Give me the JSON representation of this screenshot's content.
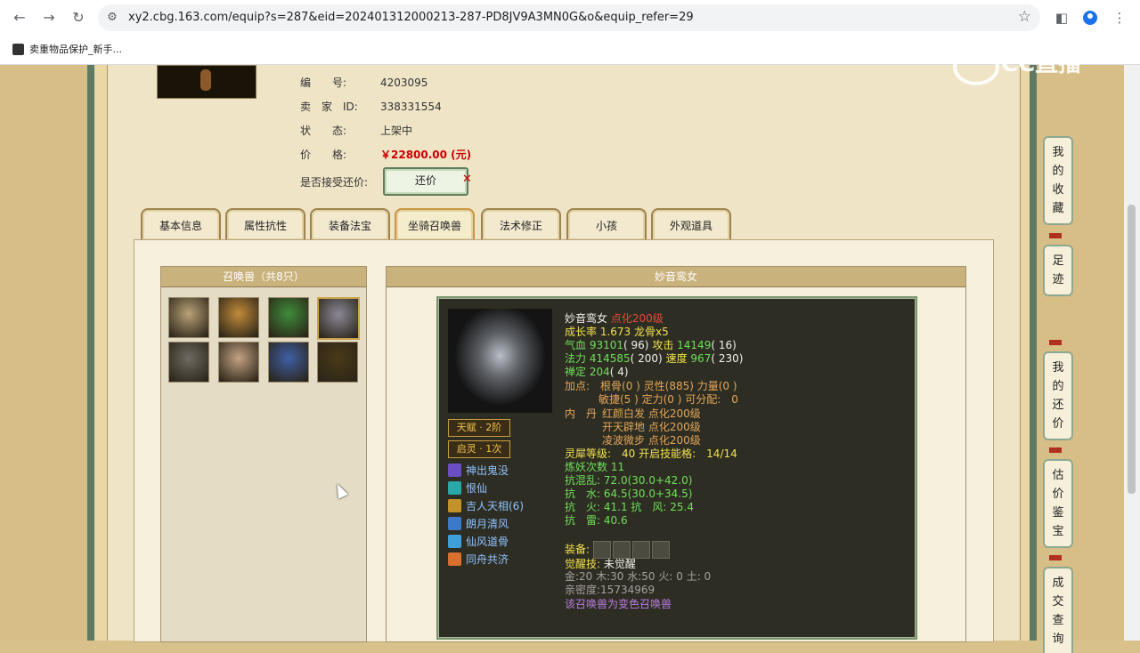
{
  "browser": {
    "url": "xy2.cbg.163.com/equip?s=287&eid=202401312000213-287-PD8JV9A3MN0G&o&equip_refer=29",
    "bookmark": "卖重物品保护_新手..."
  },
  "watermark": "CC直播",
  "item_info": {
    "id_label": "编　　号:",
    "id_value": "4203095",
    "seller_label": "卖　家　ID:",
    "seller_value": "338331554",
    "status_label": "状　　态:",
    "status_value": "上架中",
    "price_label": "价　　格:",
    "price_value": "￥22800.00 (元)",
    "counter_label": "是否接受还价:",
    "counter_button": "还价"
  },
  "tabs": [
    "基本信息",
    "属性抗性",
    "装备法宝",
    "坐骑召唤兽",
    "法术修正",
    "小孩",
    "外观道具"
  ],
  "active_tab": "坐骑召唤兽",
  "pet_list": {
    "header": "召唤兽（共8只）",
    "selected_index": 3,
    "pets": [
      {
        "icon": "golden-beast",
        "color": "#b9a277"
      },
      {
        "icon": "gold-bird",
        "color": "#c28b3a"
      },
      {
        "icon": "green-woman",
        "color": "#3f8c3a"
      },
      {
        "icon": "pale-woman",
        "color": "#8a8896"
      },
      {
        "icon": "stone-beast",
        "color": "#6d6a62"
      },
      {
        "icon": "crowned-woman",
        "color": "#c4a283"
      },
      {
        "icon": "blue-phoenix",
        "color": "#3e5fa6"
      },
      {
        "icon": "bull",
        "color": "#4a3a18"
      }
    ]
  },
  "pet_detail": {
    "header": "妙音鸾女",
    "name": "妙音鸾女",
    "name_tag": "点化200级",
    "growth": "成长率 1.673 龙骨x5",
    "hp_label": "气血",
    "hp": "93101",
    "hp_extra": "( 96)",
    "atk_label": "攻击",
    "atk": "14149",
    "atk_extra": "( 16)",
    "mp_label": "法力",
    "mp": "414585",
    "mp_extra": "( 200)",
    "spd_label": "速度",
    "spd": "967",
    "spd_extra": "( 230)",
    "zen_label": "禅定",
    "zen": "204",
    "zen_extra": "( 4)",
    "points_1": "加点:　根骨(0 ) 灵性(885) 力量(0 )",
    "points_2": "敏捷(5 ) 定力(0 ) 可分配:　0",
    "inner_label": "内　丹",
    "inner_1": "红颜白发 点化200级",
    "inner_2": "开天辟地 点化200级",
    "inner_3": "凌波微步 点化200级",
    "rhino": "灵犀等级:　40 开启技能格:　14/14",
    "refine": "炼妖次数 11",
    "res_chaos": "抗混乱: 72.0(30.0+42.0)",
    "res_water": "抗　水: 64.5(30.0+34.5)",
    "res_fire_wind": "抗　火: 41.1 抗　风: 25.4",
    "res_thunder": "抗　雷: 40.6",
    "equip_label": "装备:",
    "awaken_label": "觉醒技:",
    "awaken_value": "未觉醒",
    "elements": "金:20 木:30 水:50 火: 0 土: 0",
    "intimacy": "亲密度:15734969",
    "note": "该召唤兽为变色召唤兽",
    "badges": [
      "天赋 · 2阶",
      "启灵 · 1次"
    ],
    "skills": [
      {
        "name": "神出鬼没",
        "icon": "ghost-skill-icon",
        "color": "#6a4fc2"
      },
      {
        "name": "恨仙",
        "icon": "swirl-skill-icon",
        "color": "#2aa8a8"
      },
      {
        "name": "吉人天相(6)",
        "icon": "lucky-skill-icon",
        "color": "#c4922b"
      },
      {
        "name": "朗月清风",
        "icon": "wind-skill-icon",
        "color": "#3c79c9"
      },
      {
        "name": "仙风道骨",
        "icon": "immortal-skill-icon",
        "color": "#3fa0d9"
      },
      {
        "name": "同舟共济",
        "icon": "boat-skill-icon",
        "color": "#d9702f"
      }
    ]
  },
  "side_nav": [
    "我的收藏",
    "足迹",
    "我的还价",
    "估价鉴宝",
    "成交查询"
  ]
}
